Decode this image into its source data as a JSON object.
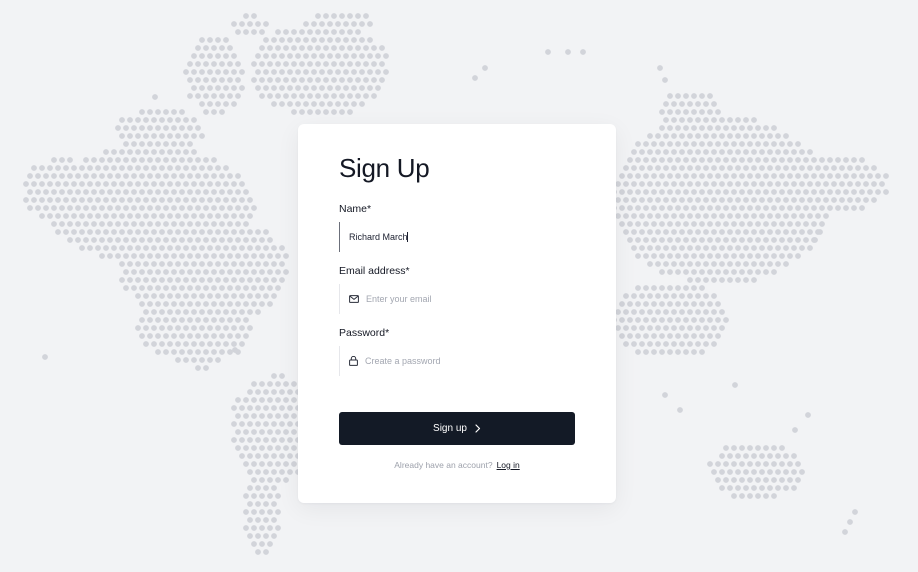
{
  "form": {
    "title": "Sign Up",
    "name_label": "Name*",
    "name_value": "Richard March",
    "email_label": "Email address*",
    "email_placeholder": "Enter your email",
    "password_label": "Password*",
    "password_placeholder": "Create a password",
    "submit_label": "Sign up",
    "footer_text": "Already have an account?",
    "login_link": "Log in"
  },
  "icons": {
    "email": "mail-icon",
    "password": "lock-icon",
    "submit": "chevron-right-icon"
  },
  "colors": {
    "background": "#f2f3f5",
    "map_dots": "#d2d4da",
    "button": "#131a26",
    "text": "#141824"
  }
}
